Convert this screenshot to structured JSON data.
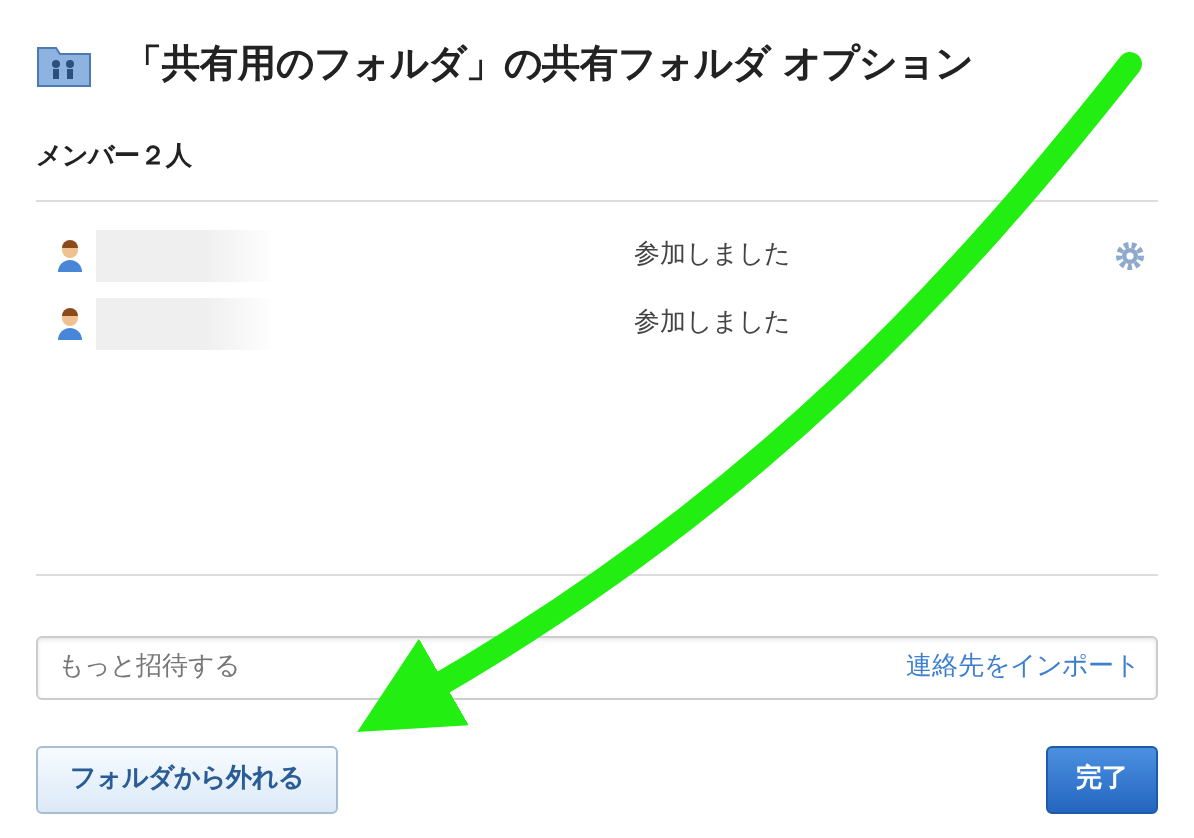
{
  "dialog": {
    "title": "「共有用のフォルダ」の共有フォルダ オプション"
  },
  "members": {
    "heading": "メンバー２人",
    "rows": [
      {
        "status": "参加しました",
        "settings": true
      },
      {
        "status": "参加しました",
        "settings": false
      }
    ]
  },
  "invite": {
    "placeholder": "もっと招待する",
    "link": "連絡先をインポート"
  },
  "buttons": [
    {
      "kind": "secondary",
      "label": "フォルダから外れる"
    },
    {
      "kind": "primary",
      "label": "完了"
    }
  ],
  "annotation": {
    "kind": "arrow"
  }
}
